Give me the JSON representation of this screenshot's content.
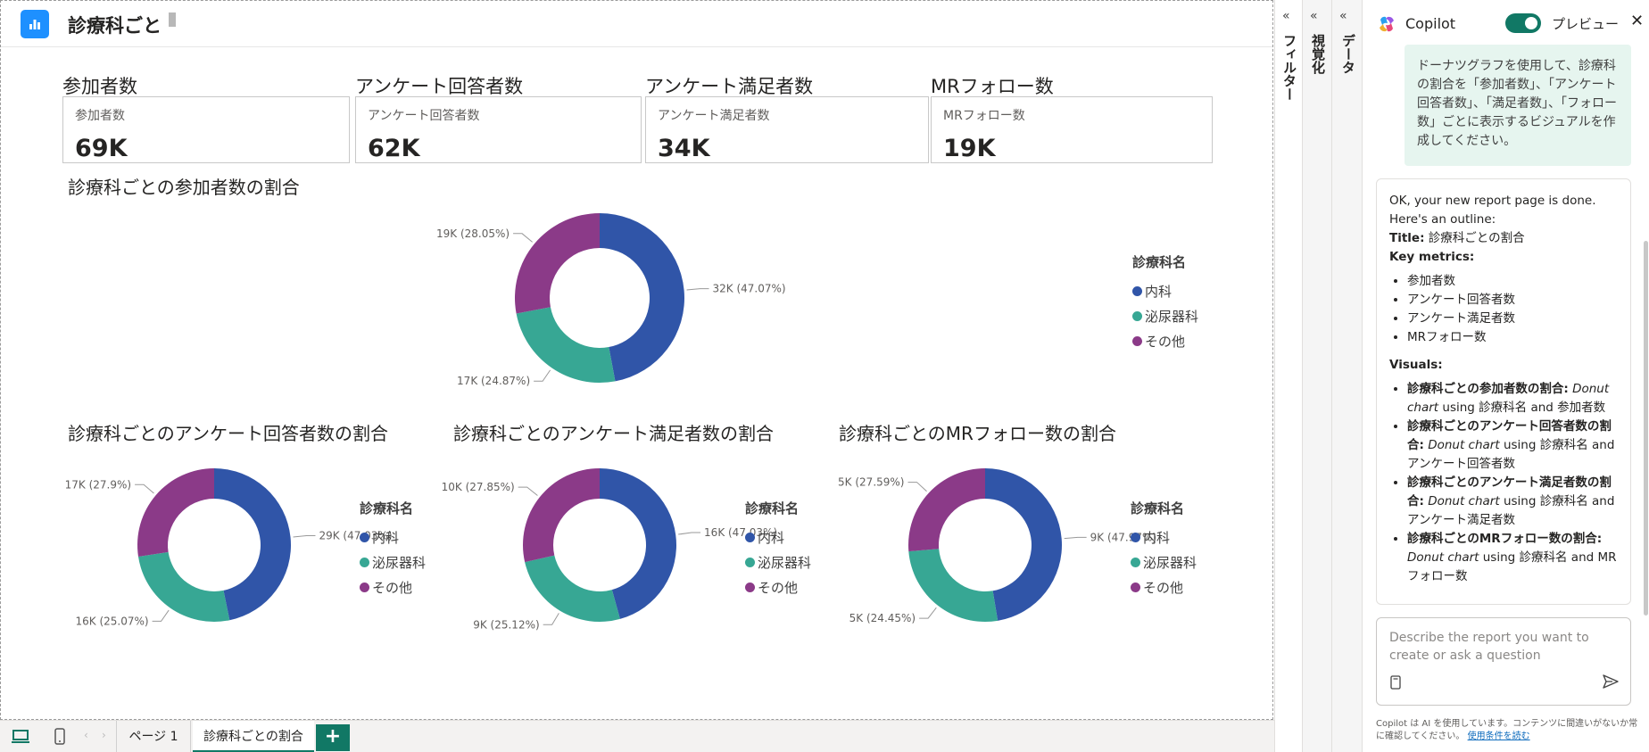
{
  "report": {
    "title": "診療科ごと",
    "kpis": [
      {
        "heading": "参加者数",
        "label": "参加者数",
        "value": "69K"
      },
      {
        "heading": "アンケート回答者数",
        "label": "アンケート回答者数",
        "value": "62K"
      },
      {
        "heading": "アンケート満足者数",
        "label": "アンケート満足者数",
        "value": "34K"
      },
      {
        "heading": "MRフォロー数",
        "label": "MRフォロー数",
        "value": "19K"
      }
    ]
  },
  "colors": {
    "naika": "#3055a8",
    "hinyoki": "#37a794",
    "sonota": "#8b3a88",
    "accent": "#117865"
  },
  "legend": {
    "title": "診療科名",
    "items": [
      "内科",
      "泌尿器科",
      "その他"
    ]
  },
  "chart_data": [
    {
      "type": "pie",
      "donut": true,
      "title": "診療科ごとの参加者数の割合",
      "categories": [
        "内科",
        "泌尿器科",
        "その他"
      ],
      "values": [
        32,
        17,
        19
      ],
      "labels": [
        "32K (47.07%)",
        "17K (24.87%)",
        "19K (28.05%)"
      ],
      "legend_title": "診療科名"
    },
    {
      "type": "pie",
      "donut": true,
      "title": "診療科ごとのアンケート回答者数の割合",
      "categories": [
        "内科",
        "泌尿器科",
        "その他"
      ],
      "values": [
        29,
        16,
        17
      ],
      "labels": [
        "29K (47.03%)",
        "16K (25.07%)",
        "17K (27.9%)"
      ],
      "legend_title": "診療科名"
    },
    {
      "type": "pie",
      "donut": true,
      "title": "診療科ごとのアンケート満足者数の割合",
      "categories": [
        "内科",
        "泌尿器科",
        "その他"
      ],
      "values": [
        16,
        9,
        10
      ],
      "labels": [
        "16K (47.03%)",
        "9K (25.12%)",
        "10K (27.85%)"
      ],
      "legend_title": "診療科名"
    },
    {
      "type": "pie",
      "donut": true,
      "title": "診療科ごとのMRフォロー数の割合",
      "categories": [
        "内科",
        "泌尿器科",
        "その他"
      ],
      "values": [
        9,
        5,
        5
      ],
      "labels": [
        "9K (47.97%)",
        "5K (24.45%)",
        "5K (27.59%)"
      ],
      "legend_title": "診療科名"
    }
  ],
  "tabs": {
    "page1": "ページ 1",
    "active": "診療科ごとの割合",
    "add": "+"
  },
  "panes": {
    "filter": "フィルター",
    "viz": "視覚化",
    "data": "データ",
    "collapse": "«"
  },
  "copilot": {
    "title": "Copilot",
    "preview": "プレビュー",
    "close": "✕",
    "user_message": "ドーナツグラフを使用して、診療科の割合を「参加者数」、「アンケート回答者数」、「満足者数」、「フォロー数」ごとに表示するビジュアルを作成してください。",
    "response_intro": "OK, your new report page is done. Here's an outline:",
    "title_label": "Title:",
    "title_value": "診療科ごとの割合",
    "key_metrics_label": "Key metrics:",
    "key_metrics": [
      "参加者数",
      "アンケート回答者数",
      "アンケート満足者数",
      "MRフォロー数"
    ],
    "visuals_label": "Visuals:",
    "visuals": [
      {
        "name": "診療科ごとの参加者数の割合:",
        "type": "Donut chart",
        "rest": "using 診療科名 and 参加者数"
      },
      {
        "name": "診療科ごとのアンケート回答者数の割合:",
        "type": "Donut chart",
        "rest": "using 診療科名 and アンケート回答者数"
      },
      {
        "name": "診療科ごとのアンケート満足者数の割合:",
        "type": "Donut chart",
        "rest": "using 診療科名 and アンケート満足者数"
      },
      {
        "name": "診療科ごとのMRフォロー数の割合:",
        "type": "Donut chart",
        "rest": "using 診療科名 and MRフォロー数"
      }
    ],
    "input_placeholder": "Describe the report you want to create or ask a question",
    "footer": "Copilot は AI を使用しています。コンテンツに間違いがないか常に確認してください。",
    "footer_link": "使用条件を読む"
  }
}
